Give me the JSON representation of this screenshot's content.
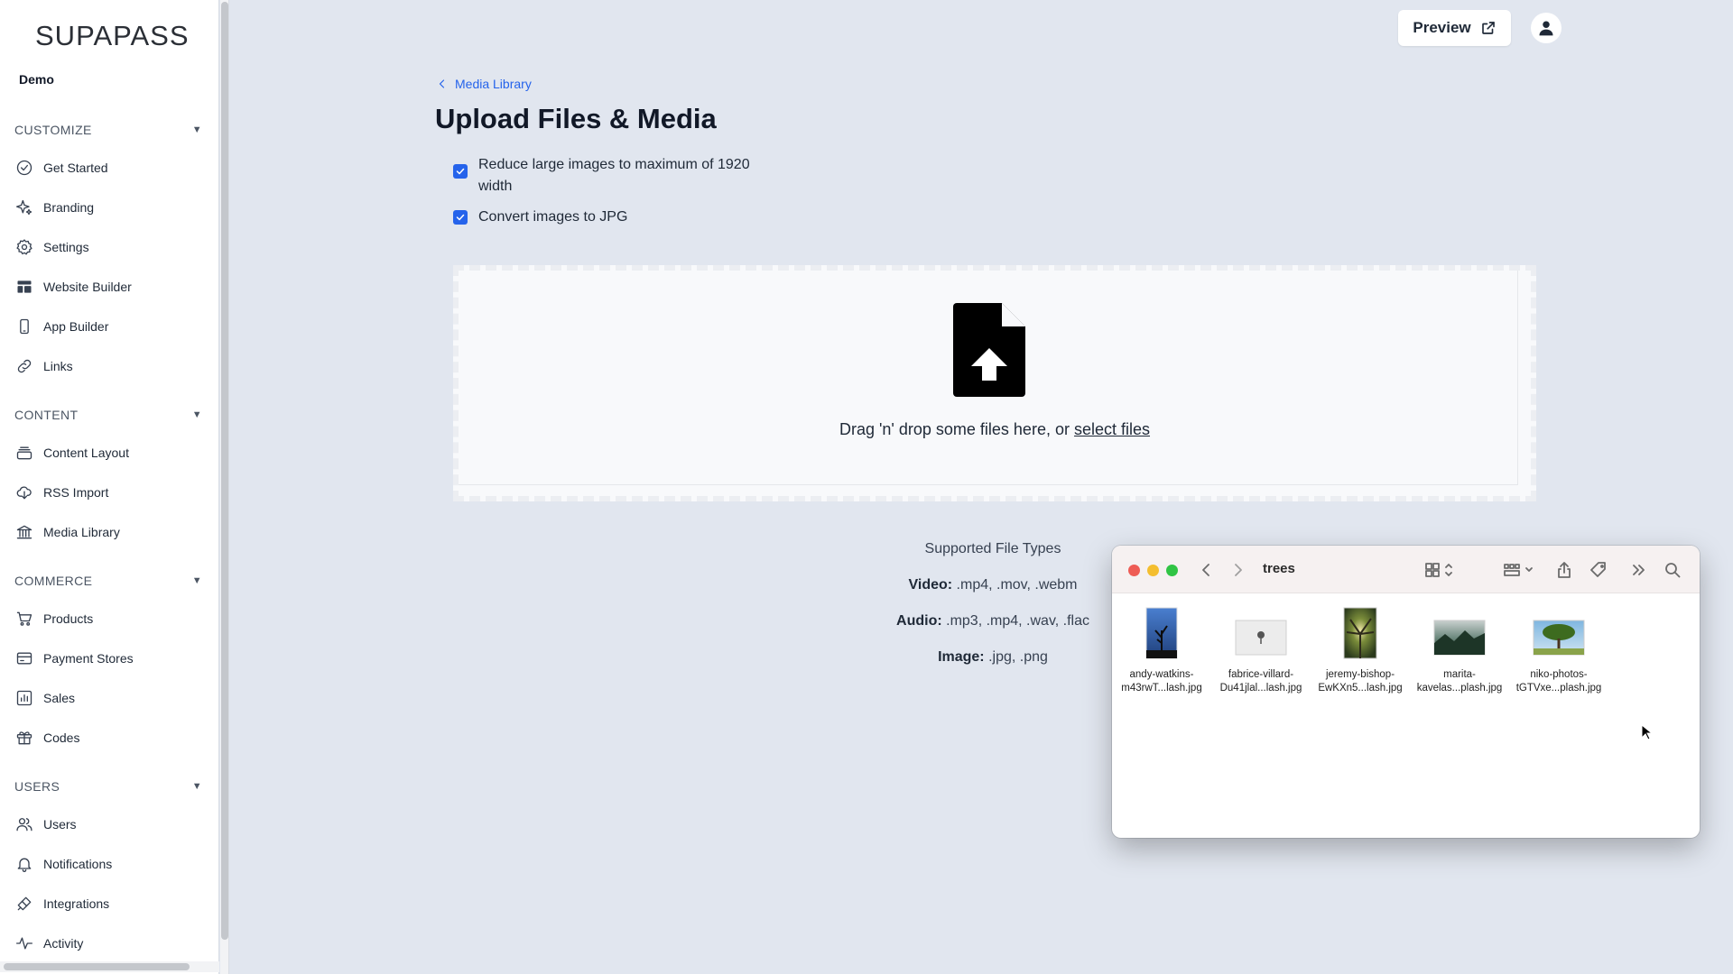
{
  "sidebar": {
    "logo": "SUPAPASS",
    "org": "Demo",
    "sections": {
      "customize": "CUSTOMIZE",
      "content": "CONTENT",
      "commerce": "COMMERCE",
      "users": "USERS"
    },
    "items": {
      "get_started": "Get Started",
      "branding": "Branding",
      "settings": "Settings",
      "website_builder": "Website Builder",
      "app_builder": "App Builder",
      "links": "Links",
      "content_layout": "Content Layout",
      "rss_import": "RSS Import",
      "media_library": "Media Library",
      "products": "Products",
      "payment_stores": "Payment Stores",
      "sales": "Sales",
      "codes": "Codes",
      "users": "Users",
      "notifications": "Notifications",
      "integrations": "Integrations",
      "activity": "Activity"
    }
  },
  "header": {
    "preview_label": "Preview"
  },
  "main": {
    "breadcrumb": "Media Library",
    "title": "Upload Files & Media",
    "options": [
      {
        "label_line1": "Reduce large images to maximum of 1920",
        "label_line2": "width",
        "checked": true
      },
      {
        "label_line1": "Convert images to JPG",
        "checked": true
      }
    ],
    "dropzone": {
      "text": "Drag 'n' drop some files here, or ",
      "link": "select files"
    },
    "supported": {
      "heading": "Supported File Types",
      "video_label": "Video:",
      "video_types": " .mp4, .mov, .webm",
      "audio_label": "Audio:",
      "audio_types": " .mp3, .mp4, .wav, .flac",
      "image_label": "Image:",
      "image_types": " .jpg, .png"
    }
  },
  "finder": {
    "title": "trees",
    "files": [
      {
        "line1": "andy-watkins-",
        "line2": "m43rwT...lash.jpg"
      },
      {
        "line1": "fabrice-villard-",
        "line2": "Du41jlal...lash.jpg"
      },
      {
        "line1": "jeremy-bishop-",
        "line2": "EwKXn5...lash.jpg"
      },
      {
        "line1": "marita-",
        "line2": "kavelas...plash.jpg"
      },
      {
        "line1": "niko-photos-",
        "line2": "tGTVxe...plash.jpg"
      }
    ]
  },
  "colors": {
    "accent": "#2563eb",
    "background": "#e1e6ef"
  }
}
